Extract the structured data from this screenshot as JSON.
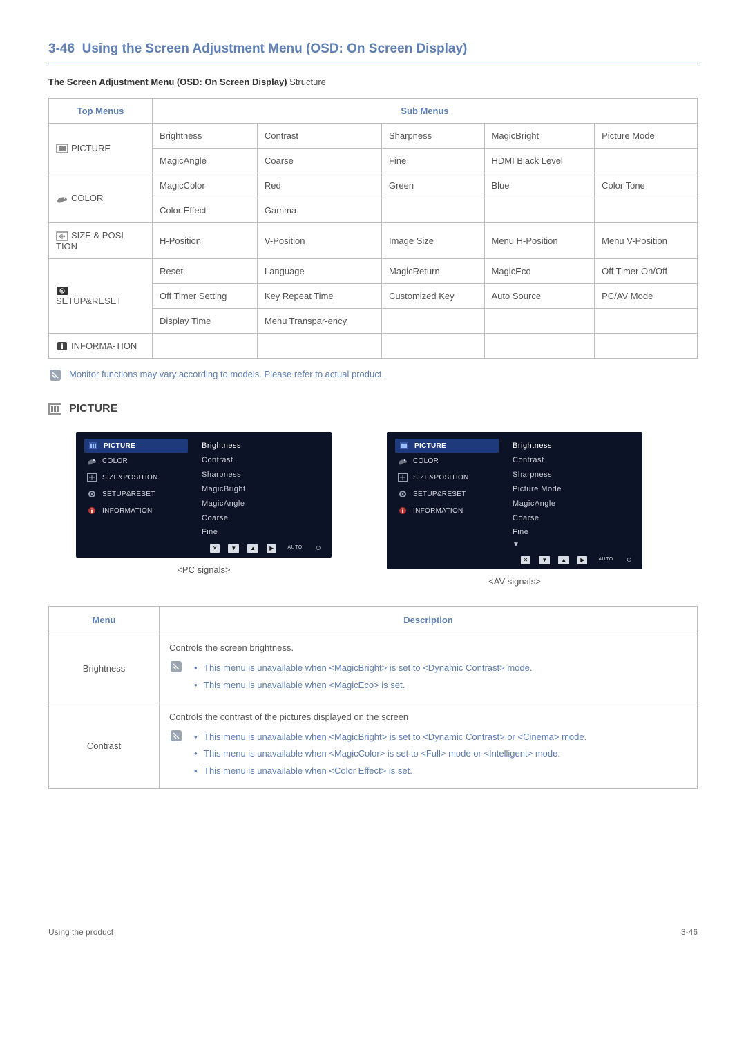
{
  "section": {
    "number": "3-46",
    "title": "Using the Screen Adjustment Menu (OSD: On Screen Display)"
  },
  "struct_table": {
    "subtitle_bold": "The Screen Adjustment Menu (OSD: On Screen Display)",
    "subtitle_rest": " Structure",
    "header_top": "Top Menus",
    "header_sub": "Sub Menus",
    "rows": [
      {
        "top": "PICTURE",
        "cells": [
          [
            "Brightness",
            "Contrast",
            "Sharpness",
            "MagicBright",
            "Picture Mode"
          ],
          [
            "MagicAngle",
            "Coarse",
            "Fine",
            "HDMI Black Level",
            ""
          ]
        ]
      },
      {
        "top": "COLOR",
        "cells": [
          [
            "MagicColor",
            "Red",
            "Green",
            "Blue",
            "Color Tone"
          ],
          [
            "Color Effect",
            "Gamma",
            "",
            "",
            ""
          ]
        ]
      },
      {
        "top": "SIZE & POSI-TION",
        "cells": [
          [
            "H-Position",
            "V-Position",
            "Image Size",
            "Menu H-Position",
            "Menu V-Position"
          ]
        ]
      },
      {
        "top": "SETUP&RESET",
        "cells": [
          [
            "Reset",
            "Language",
            "MagicReturn",
            "MagicEco",
            "Off Timer On/Off"
          ],
          [
            "Off Timer Setting",
            "Key Repeat Time",
            "Customized Key",
            "Auto Source",
            "PC/AV Mode"
          ],
          [
            "Display Time",
            "Menu Transpar-ency",
            "",
            "",
            ""
          ]
        ]
      },
      {
        "top": "INFORMA-TION",
        "cells": [
          [
            "",
            "",
            "",
            "",
            ""
          ]
        ]
      }
    ]
  },
  "struct_note": "Monitor functions may vary according to models. Please refer to actual product.",
  "picture_heading": "PICTURE",
  "osd": {
    "left_items": [
      "PICTURE",
      "COLOR",
      "SIZE&POSITION",
      "SETUP&RESET",
      "INFORMATION"
    ],
    "pc_right": [
      "Brightness",
      "Contrast",
      "Sharpness",
      "MagicBright",
      "MagicAngle",
      "Coarse",
      "Fine"
    ],
    "av_right": [
      "Brightness",
      "Contrast",
      "Sharpness",
      "Picture Mode",
      "MagicAngle",
      "Coarse",
      "Fine"
    ],
    "bottom_auto": "AUTO",
    "pc_caption": "<PC signals>",
    "av_caption": "<AV signals>"
  },
  "desc_table": {
    "header_menu": "Menu",
    "header_desc": "Description",
    "rows": [
      {
        "menu": "Brightness",
        "lead": "Controls the screen brightness.",
        "notes": [
          "This menu is unavailable when <MagicBright> is set to <Dynamic Contrast> mode.",
          "This menu is unavailable when <MagicEco> is set."
        ]
      },
      {
        "menu": "Contrast",
        "lead": "Controls the contrast of the pictures displayed on the screen",
        "notes": [
          "This menu is unavailable when <MagicBright> is set to <Dynamic Contrast> or <Cinema> mode.",
          "This menu is unavailable when <MagicColor> is set to <Full> mode or <Intelligent> mode.",
          "This menu is unavailable when <Color Effect> is set."
        ]
      }
    ]
  },
  "footer": {
    "left": "Using the product",
    "right": "3-46"
  }
}
